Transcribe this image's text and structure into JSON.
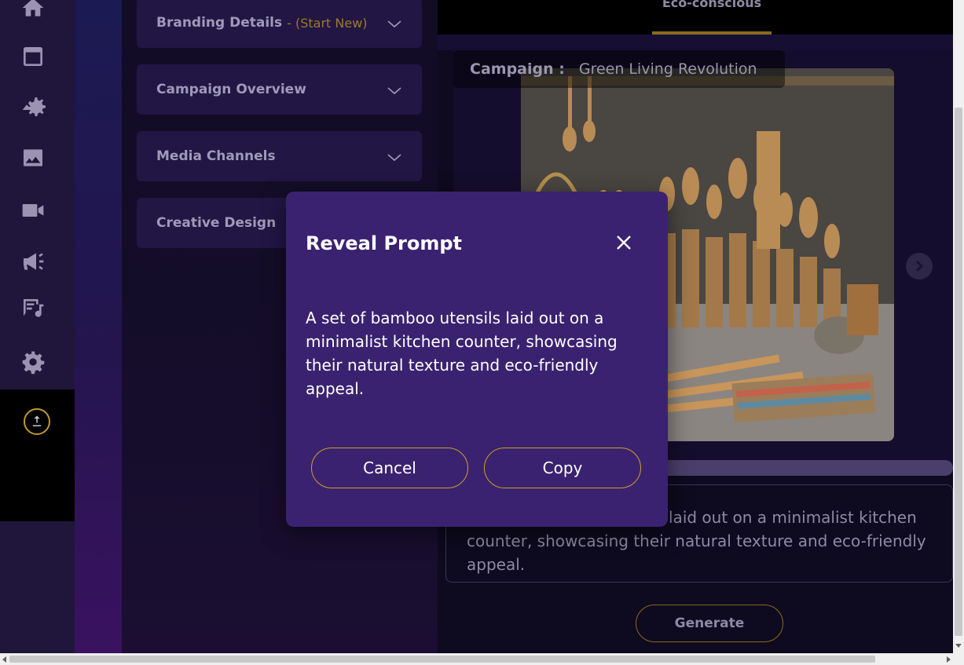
{
  "sidebar": {
    "icons": [
      "home-icon",
      "document-icon",
      "campaign-settings-icon",
      "image-icon",
      "video-icon",
      "megaphone-icon",
      "music-text-icon",
      "settings-icon"
    ],
    "upload_icon": "upload-icon"
  },
  "accordion": {
    "items": [
      {
        "title": "Branding Details",
        "subtitle": "- (Start New)"
      },
      {
        "title": "Campaign Overview"
      },
      {
        "title": "Media Channels"
      },
      {
        "title": "Creative Design"
      }
    ]
  },
  "tabs": {
    "active_label": "Eco-conscious"
  },
  "campaign": {
    "label": "Campaign :",
    "value": "Green Living Revolution"
  },
  "prompt_preview": "A set of bamboo utensils laid out on a minimalist kitchen counter, showcasing their natural texture and eco-friendly appeal.",
  "prompt_visible_text": "laid out on a minimalist kitchen counter, showcasing their natural texture and eco-friendly appeal.",
  "generate_label": "Generate",
  "modal": {
    "title": "Reveal Prompt",
    "body": "A set of bamboo utensils laid out on a minimalist kitchen counter, showcasing their natural texture and eco-friendly appeal.",
    "cancel_label": "Cancel",
    "copy_label": "Copy"
  },
  "colors": {
    "accent_gold": "#c9a02a",
    "modal_bg": "#3b2270",
    "sidebar_bg": "#20163b"
  }
}
